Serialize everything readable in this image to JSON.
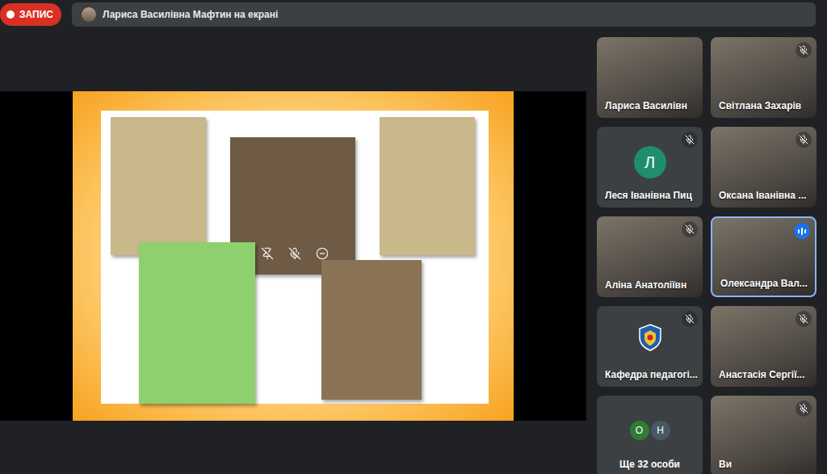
{
  "recording": {
    "label": "ЗАПИС"
  },
  "presenter": {
    "text": "Лариса Василівна Мафтин на екрані"
  },
  "slide": {
    "books": [
      {
        "color": "#c9b98a"
      },
      {
        "color": "#6e5a45"
      },
      {
        "color": "#c9b98a"
      },
      {
        "color": "#8fd06e"
      },
      {
        "color": "#8a7355"
      }
    ]
  },
  "participants": [
    {
      "name": "Лариса Василівн",
      "kind": "video",
      "muted": false,
      "speaking": false
    },
    {
      "name": "Світлана Захарів",
      "kind": "video",
      "muted": true,
      "speaking": false
    },
    {
      "name": "Леся Іванівна Пиц",
      "kind": "avatar",
      "muted": true,
      "speaking": false,
      "initial": "Л",
      "color": "#1e8e6e"
    },
    {
      "name": "Оксана Іванівна ...",
      "kind": "video",
      "muted": true,
      "speaking": false
    },
    {
      "name": "Аліна Анатоліївн",
      "kind": "video",
      "muted": true,
      "speaking": false
    },
    {
      "name": "Олександра Вал...",
      "kind": "video",
      "muted": false,
      "speaking": true
    },
    {
      "name": "Кафедра педагогі...",
      "kind": "logo",
      "muted": true,
      "speaking": false
    },
    {
      "name": "Анастасія Сергії...",
      "kind": "video",
      "muted": true,
      "speaking": false
    },
    {
      "name": "Ще 32 особи",
      "kind": "more",
      "muted": false,
      "speaking": false,
      "initials": [
        {
          "letter": "О",
          "color": "#2e7d32"
        },
        {
          "letter": "Н",
          "color": "#455a64"
        }
      ]
    },
    {
      "name": "Ви",
      "kind": "video",
      "muted": true,
      "speaking": false
    }
  ]
}
